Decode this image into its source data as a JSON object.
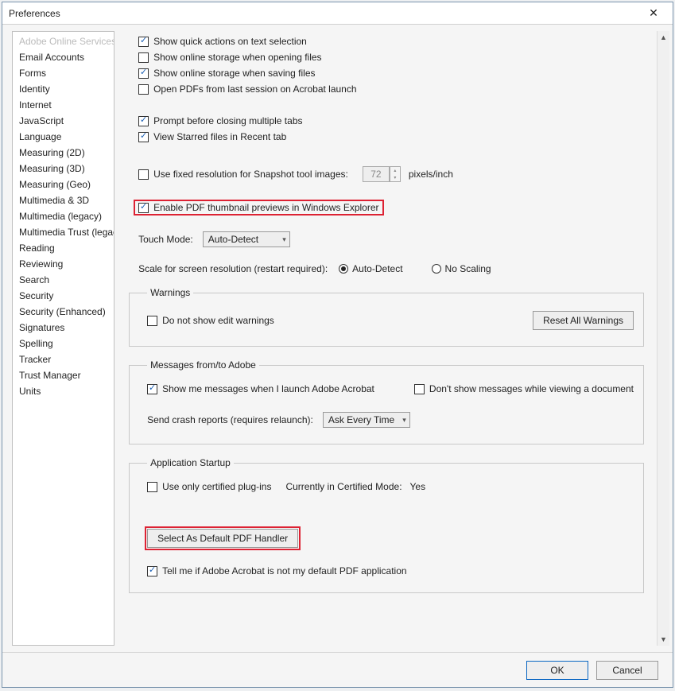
{
  "window": {
    "title": "Preferences"
  },
  "sidebar": {
    "categories": [
      "Adobe Online Services",
      "Email Accounts",
      "Forms",
      "Identity",
      "Internet",
      "JavaScript",
      "Language",
      "Measuring (2D)",
      "Measuring (3D)",
      "Measuring (Geo)",
      "Multimedia & 3D",
      "Multimedia (legacy)",
      "Multimedia Trust (legacy)",
      "Reading",
      "Reviewing",
      "Search",
      "Security",
      "Security (Enhanced)",
      "Signatures",
      "Spelling",
      "Tracker",
      "Trust Manager",
      "Units"
    ]
  },
  "opts": {
    "quick_actions": "Show quick actions on text selection",
    "open_storage": "Show online storage when opening files",
    "save_storage": "Show online storage when saving files",
    "last_session": "Open PDFs from last session on Acrobat launch",
    "prompt_tabs": "Prompt before closing multiple tabs",
    "starred": "View Starred files in Recent tab",
    "snapshot": "Use fixed resolution for Snapshot tool images:",
    "snapshot_val": "72",
    "snapshot_unit": "pixels/inch",
    "thumb": "Enable PDF thumbnail previews in Windows Explorer",
    "touch_label": "Touch Mode:",
    "touch_value": "Auto-Detect",
    "scale_label": "Scale for screen resolution (restart required):",
    "scale_auto": "Auto-Detect",
    "scale_none": "No Scaling"
  },
  "warnings": {
    "legend": "Warnings",
    "no_edit": "Do not show edit warnings",
    "reset_btn": "Reset All Warnings"
  },
  "messages": {
    "legend": "Messages from/to Adobe",
    "show_launch": "Show me messages when I launch Adobe Acrobat",
    "hide_viewing": "Don't show messages while viewing a document",
    "crash_label": "Send crash reports (requires relaunch):",
    "crash_value": "Ask Every Time"
  },
  "startup": {
    "legend": "Application Startup",
    "certified": "Use only certified plug-ins",
    "cert_mode_label": "Currently in Certified Mode:",
    "cert_mode_value": "Yes",
    "default_handler_btn": "Select As Default PDF Handler",
    "tell_default": "Tell me if Adobe Acrobat is not my default PDF application"
  },
  "footer": {
    "ok": "OK",
    "cancel": "Cancel"
  }
}
